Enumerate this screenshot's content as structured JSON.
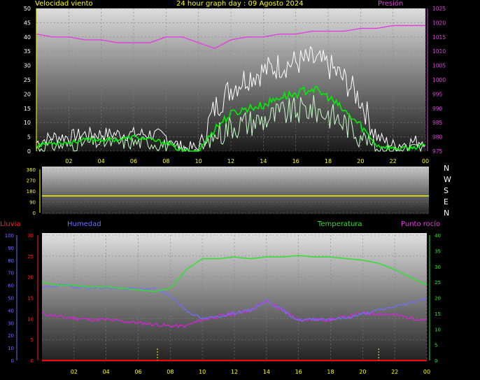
{
  "header": {
    "left_label": "Velocidad viento",
    "title": "24 hour graph day : 09 Agosto 2024",
    "right_label": "Presión"
  },
  "direction_letters": [
    "N",
    "W",
    "S",
    "E",
    "N"
  ],
  "bottom_labels": {
    "rain": "Lluvia",
    "humidity": "Humedad",
    "temperature": "Temperatura",
    "dewpoint": "Punto rocío"
  },
  "colors": {
    "wind_gust": "#ffffff",
    "wind_avg": "#00ee00",
    "wind_speed": "#c8ffc8",
    "pressure": "#e040e0",
    "direction": "#ffff00",
    "rain": "#ff0000",
    "humidity": "#7070ff",
    "temperature": "#30e030",
    "dewpoint": "#e020e0",
    "axis_yellow": "#ffff00"
  },
  "chart_data": [
    {
      "type": "line",
      "x_ticks": [
        "02",
        "04",
        "06",
        "08",
        "10",
        "12",
        "14",
        "16",
        "18",
        "20",
        "22",
        "00"
      ],
      "y_left_ticks": [
        "0",
        "5",
        "10",
        "15",
        "20",
        "25",
        "30",
        "35",
        "40",
        "45",
        "50"
      ],
      "y_right_ticks": [
        "975",
        "980",
        "985",
        "990",
        "995",
        "1000",
        "1005",
        "1010",
        "1015",
        "1020",
        "1025"
      ],
      "ylim_left": [
        0,
        50
      ],
      "ylim_right": [
        975,
        1025
      ],
      "x_hours": [
        0,
        1,
        2,
        3,
        4,
        5,
        6,
        7,
        8,
        9,
        10,
        11,
        12,
        13,
        14,
        15,
        16,
        17,
        18,
        19,
        20,
        21,
        22,
        23,
        24
      ],
      "series": [
        {
          "values": [
            3,
            5,
            5,
            6,
            6,
            6,
            6,
            6,
            5,
            1,
            1,
            15,
            22,
            26,
            28,
            30,
            31,
            32,
            30,
            25,
            18,
            5,
            2,
            3,
            4
          ]
        },
        {
          "values": [
            2,
            3,
            3,
            4,
            4,
            4,
            5,
            4,
            3,
            0,
            0,
            8,
            13,
            15,
            16,
            19,
            20,
            22,
            19,
            14,
            9,
            2,
            1,
            1,
            2
          ]
        },
        {
          "values": [
            1,
            2,
            2,
            3,
            3,
            3,
            3,
            3,
            2,
            0,
            0,
            5,
            9,
            10,
            11,
            13,
            14,
            15,
            13,
            10,
            6,
            1,
            0,
            1,
            1
          ]
        },
        {
          "name": "Presión",
          "values": [
            1016,
            1015,
            1015,
            1014,
            1014,
            1013,
            1013,
            1013,
            1015,
            1015,
            1013,
            1011,
            1014,
            1015,
            1015,
            1016,
            1016,
            1017,
            1017,
            1017,
            1018,
            1018,
            1019,
            1019,
            1019
          ]
        }
      ]
    },
    {
      "type": "line",
      "y_ticks": [
        "0",
        "90",
        "180",
        "270",
        "360"
      ],
      "ylim": [
        0,
        360
      ],
      "x_hours": [
        0,
        24
      ],
      "series": [
        {
          "values": [
            140,
            140
          ]
        }
      ]
    },
    {
      "type": "line",
      "x_ticks": [
        "02",
        "04",
        "06",
        "08",
        "10",
        "12",
        "14",
        "16",
        "18",
        "20",
        "22",
        "00"
      ],
      "y_left_outer_ticks": [
        "0",
        "10",
        "20",
        "30",
        "40",
        "50",
        "60",
        "70",
        "80",
        "90",
        "100"
      ],
      "y_left_inner_ticks": [
        "0",
        "5",
        "10",
        "15",
        "20",
        "25",
        "30"
      ],
      "y_right_ticks": [
        "0",
        "5",
        "10",
        "15",
        "20",
        "25",
        "30",
        "35",
        "40"
      ],
      "ylim_humidity": [
        0,
        100
      ],
      "ylim_rain": [
        0,
        30
      ],
      "ylim_temperature": [
        0,
        40
      ],
      "x_hours": [
        0,
        1,
        2,
        3,
        4,
        5,
        6,
        7,
        8,
        9,
        10,
        11,
        12,
        13,
        14,
        15,
        16,
        17,
        18,
        19,
        20,
        21,
        22,
        23,
        24
      ],
      "series": [
        {
          "name": "Lluvia",
          "values": [
            0,
            0,
            0,
            0,
            0,
            0,
            0,
            0,
            0,
            0,
            0,
            0,
            0,
            0,
            0,
            0,
            0,
            0,
            0,
            0,
            0,
            0,
            0,
            0,
            0
          ]
        },
        {
          "name": "Humedad",
          "values": [
            58,
            60,
            59,
            58,
            58,
            57,
            57,
            57,
            52,
            40,
            33,
            35,
            38,
            40,
            48,
            40,
            32,
            33,
            33,
            34,
            37,
            40,
            43,
            46,
            50
          ]
        },
        {
          "name": "Temperatura",
          "values": [
            25,
            24,
            24,
            23.5,
            23.5,
            23,
            22.5,
            22,
            23,
            29,
            32.5,
            32.5,
            33,
            32.5,
            33,
            33,
            33.5,
            33,
            33,
            32.5,
            32,
            31,
            29,
            26.5,
            24
          ]
        },
        {
          "name": "Punto rocío",
          "values": [
            15,
            14,
            13.5,
            13,
            13,
            12.5,
            12,
            11.5,
            11,
            11,
            13,
            14,
            15,
            16,
            19,
            16,
            13,
            13,
            13,
            14,
            15,
            15,
            14.5,
            13.5,
            13
          ]
        }
      ]
    }
  ]
}
